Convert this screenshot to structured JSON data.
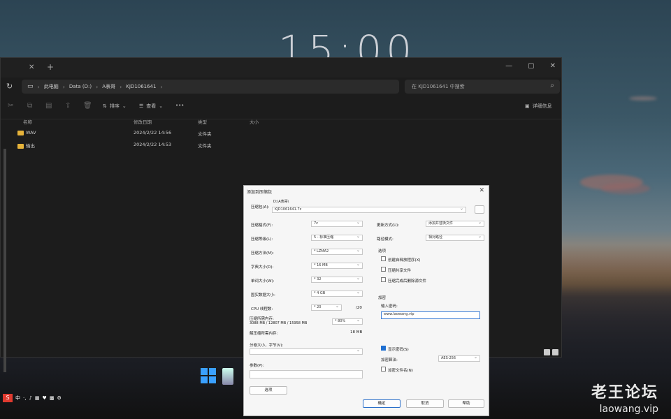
{
  "desktop": {
    "clock": "15:00"
  },
  "explorer": {
    "breadcrumb": [
      "此电脑",
      "Data (D:)",
      "A表哥",
      "KJD1061641"
    ],
    "search_placeholder": "在 KJD1061641 中搜索",
    "toolbar": {
      "sort": "排序",
      "view": "查看",
      "more": "•••",
      "details": "详细信息"
    },
    "columns": {
      "name": "名称",
      "date": "修改日期",
      "type": "类型",
      "size": "大小"
    },
    "files": [
      {
        "name": "WAV",
        "date": "2024/2/22 14:56",
        "type": "文件夹"
      },
      {
        "name": "输出",
        "date": "2024/2/22 14:53",
        "type": "文件夹"
      }
    ]
  },
  "dialog": {
    "title": "添加到压缩包",
    "archive_label": "压缩包(A):",
    "archive_path": "D:\\A表哥\\",
    "archive_name": "KJD1061641.7z",
    "format_label": "压缩格式(F):",
    "format_value": "7z",
    "level_label": "压缩等级(L):",
    "level_value": "5 - 标准压缩",
    "method_label": "压缩方法(M):",
    "method_value": "* LZMA2",
    "dict_label": "字典大小(D):",
    "dict_value": "* 16 MB",
    "word_label": "单词大小(W):",
    "word_value": "* 32",
    "solid_label": "固实数据大小:",
    "solid_value": "* 4 GB",
    "cpu_label": "CPU 线程数:",
    "cpu_value": "* 20",
    "cpu_total": "/20",
    "mem_label": "压缩所需内存:",
    "mem_detail": "3088 MB / 12807 MB / 15958 MB",
    "mem_value": "* 80%",
    "decomp_label": "解压缩所需内存:",
    "decomp_value": "18 MB",
    "split_label": "分卷大小，字节(V):",
    "params_label": "参数(P):",
    "options_btn": "选项",
    "update_label": "更新方式(U):",
    "update_value": "添加并替换文件",
    "pathmode_label": "路径模式:",
    "pathmode_value": "相对路径",
    "opts_title": "选项",
    "opt1": "创建自释放程序(X)",
    "opt2": "压缩共享文件",
    "opt3": "压缩完成后删除源文件",
    "enc_title": "加密",
    "pwd_label": "输入密码:",
    "pwd_value": "www.laowang.vip",
    "show_pwd": "显示密码(S)",
    "enc_method_label": "加密算法:",
    "enc_method_value": "AES-256",
    "enc_names": "加密文件名(N)",
    "ok": "确定",
    "cancel": "取消",
    "help": "帮助"
  },
  "watermark": {
    "cn": "老王论坛",
    "url": "laowang.vip"
  }
}
